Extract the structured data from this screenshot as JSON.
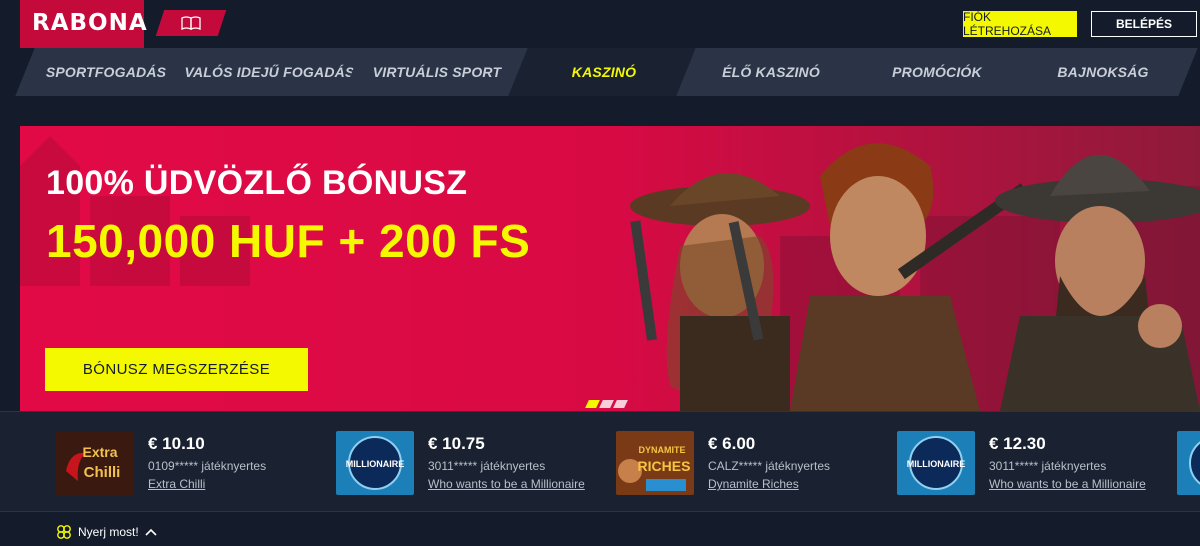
{
  "header": {
    "logo": "RABONA",
    "create_account": "FIÓK LÉTREHOZÁSA",
    "login": "BELÉPÉS",
    "book_icon": "book-icon"
  },
  "nav": {
    "items": [
      {
        "label": "SPORTFOGADÁS",
        "active": false
      },
      {
        "label": "VALÓS IDEJŰ FOGADÁS",
        "active": false
      },
      {
        "label": "VIRTUÁLIS SPORT",
        "active": false
      },
      {
        "label": "KASZINÓ",
        "active": true
      },
      {
        "label": "ÉLŐ KASZINÓ",
        "active": false
      },
      {
        "label": "PROMÓCIÓK",
        "active": false
      },
      {
        "label": "BAJNOKSÁG",
        "active": false
      }
    ]
  },
  "banner": {
    "line1": "100% ÜDVÖZLŐ BÓNUSZ",
    "line2": "150,000 HUF + 200 FS",
    "cta": "BÓNUSZ MEGSZERZÉSE",
    "slides": 3,
    "active_slide": 1
  },
  "winners": [
    {
      "amount": "€ 10.10",
      "user": "0109***** játéknyertes",
      "game": "Extra Chilli"
    },
    {
      "amount": "€ 10.75",
      "user": "3011***** játéknyertes",
      "game": "Who wants to be a Millionaire"
    },
    {
      "amount": "€ 6.00",
      "user": "CALZ***** játéknyertes",
      "game": "Dynamite Riches"
    },
    {
      "amount": "€ 12.30",
      "user": "3011***** játéknyertes",
      "game": "Who wants to be a Millionaire"
    }
  ],
  "footer": {
    "win_now": "Nyerj most!"
  },
  "colors": {
    "accent": "#f4f900",
    "brand": "#e20a46",
    "background": "#141c2b"
  }
}
